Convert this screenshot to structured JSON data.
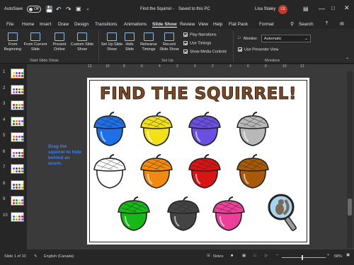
{
  "titlebar": {
    "autosave_label": "AutoSave",
    "autosave_state": "Off",
    "doc_title": "Find the Squirrel",
    "save_status": "Saved to this PC",
    "user_name": "Lisa Staley",
    "user_initials": "LS"
  },
  "menu": {
    "items": [
      "File",
      "Home",
      "Insert",
      "Draw",
      "Design",
      "Transitions",
      "Animations",
      "Slide Show",
      "Review",
      "View",
      "Help",
      "Flat Pack",
      "Format"
    ],
    "active": "Slide Show",
    "search_label": "Search"
  },
  "ribbon": {
    "start": {
      "from_beginning": "From Beginning",
      "from_current": "From Current Slide",
      "present_online": "Present Online",
      "custom_show": "Custom Slide Show",
      "group_label": "Start Slide Show"
    },
    "setup": {
      "set_up": "Set Up Slide Show",
      "hide": "Hide Slide",
      "rehearse": "Rehearse Timings",
      "record": "Record Slide Show",
      "play_narrations": "Play Narrations",
      "use_timings": "Use Timings",
      "show_media": "Show Media Controls",
      "group_label": "Set Up"
    },
    "monitors": {
      "monitor_label": "Monitor:",
      "monitor_value": "Automatic",
      "presenter_view": "Use Presenter View",
      "group_label": "Monitors"
    }
  },
  "thumbnails": {
    "numbers": [
      "1",
      "2",
      "3",
      "4",
      "5",
      "6",
      "7",
      "8",
      "9",
      "10"
    ]
  },
  "ruler": {
    "labels": [
      "12",
      "10",
      "8",
      "6",
      "4",
      "2",
      "0",
      "2",
      "4",
      "6",
      "8",
      "10",
      "12"
    ]
  },
  "slide": {
    "title": "FIND THE SQUIRREL!",
    "instruction": "Drag the squirrel to hide behind an acorn.",
    "acorns": [
      {
        "color": "#1e6fe8"
      },
      {
        "color": "#f2e01a"
      },
      {
        "color": "#6a4fe0"
      },
      {
        "color": "#b8b8b8"
      },
      {
        "color": "#ffffff"
      },
      {
        "color": "#f28a12"
      },
      {
        "color": "#d81414"
      },
      {
        "color": "#a85a0a"
      },
      {
        "color": "#18b818"
      },
      {
        "color": "#444444"
      },
      {
        "color": "#ec3f9a"
      }
    ]
  },
  "statusbar": {
    "slide_counter": "Slide 1 of 10",
    "language": "English (Canada)",
    "notes": "Notes",
    "zoom": "68%"
  }
}
